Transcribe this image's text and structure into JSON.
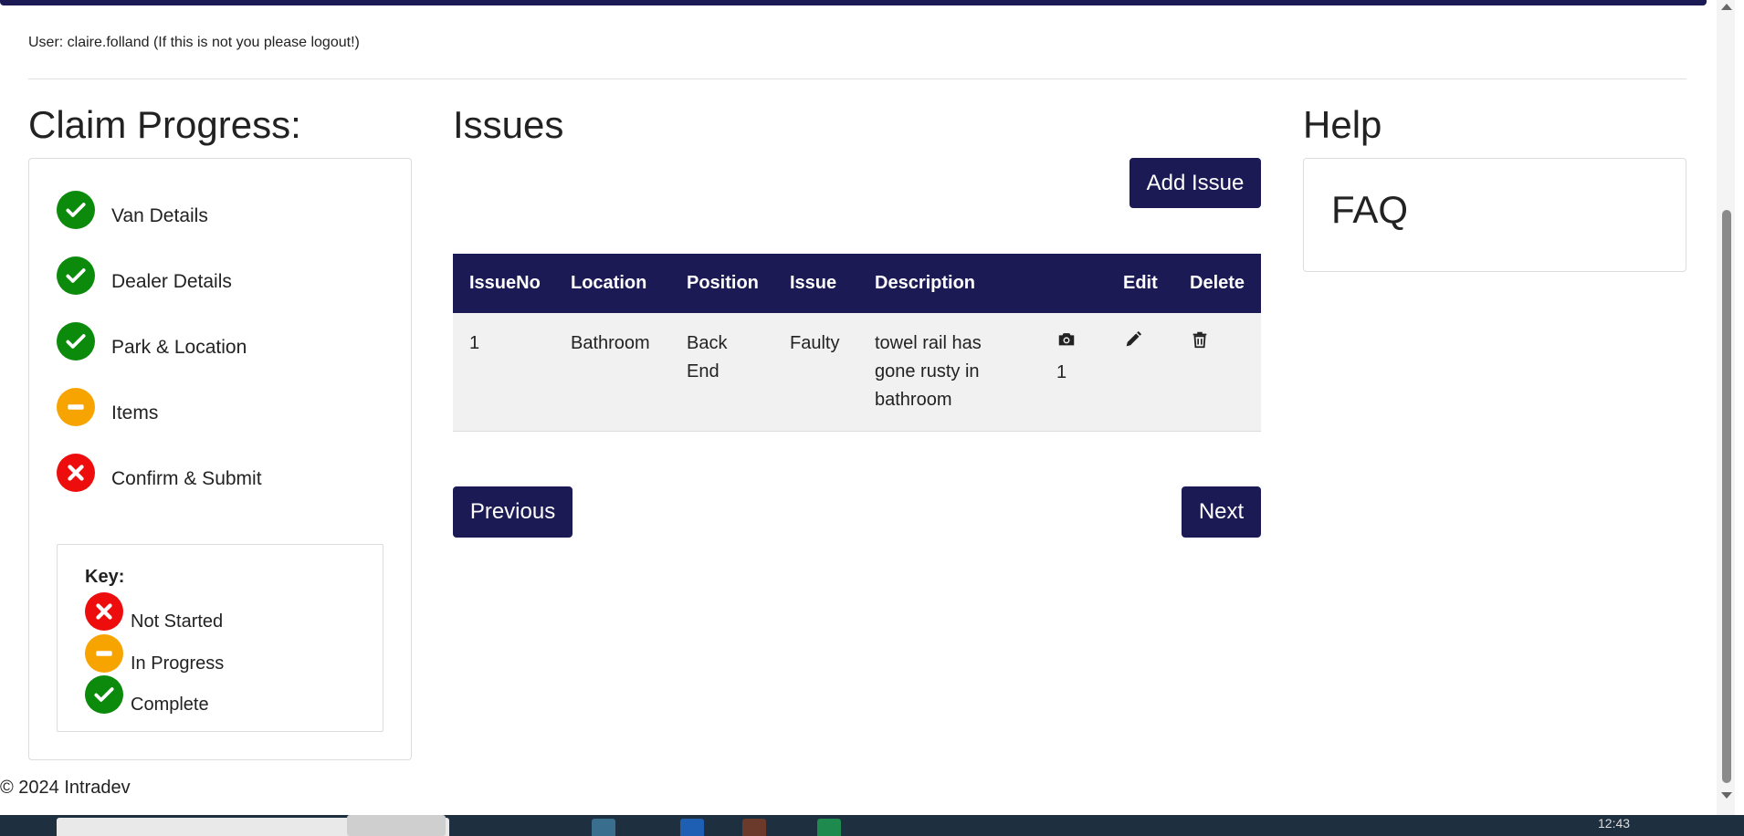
{
  "user_line": "User: claire.folland (If this is not you please logout!)",
  "progress": {
    "title": "Claim Progress:",
    "steps": [
      {
        "label": "Van Details",
        "status": "complete"
      },
      {
        "label": "Dealer Details",
        "status": "complete"
      },
      {
        "label": "Park & Location",
        "status": "complete"
      },
      {
        "label": "Items",
        "status": "in-progress"
      },
      {
        "label": "Confirm & Submit",
        "status": "not-started"
      }
    ],
    "key": {
      "title": "Key:",
      "items": [
        {
          "label": "Not Started",
          "status": "not-started"
        },
        {
          "label": "In Progress",
          "status": "in-progress"
        },
        {
          "label": "Complete",
          "status": "complete"
        }
      ]
    }
  },
  "issues": {
    "title": "Issues",
    "add_button": "Add Issue",
    "columns": [
      "IssueNo",
      "Location",
      "Position",
      "Issue",
      "Description",
      "",
      "Edit",
      "Delete"
    ],
    "rows": [
      {
        "issue_no": "1",
        "location": "Bathroom",
        "position": "Back End",
        "issue": "Faulty",
        "description": "towel rail has gone rusty in bathroom",
        "photo_icon": "camera-icon",
        "photo_count": "1",
        "edit_icon": "pencil-icon",
        "delete_icon": "trash-icon"
      }
    ],
    "previous_button": "Previous",
    "next_button": "Next"
  },
  "help": {
    "title": "Help",
    "faq": "FAQ"
  },
  "footer": "© 2024 Intradev",
  "taskbar": {
    "time": "12:43"
  },
  "colors": {
    "primary": "#1c1a55",
    "complete": "#0b8a0b",
    "in_progress": "#f8a400",
    "not_started": "#ee0d0d"
  }
}
